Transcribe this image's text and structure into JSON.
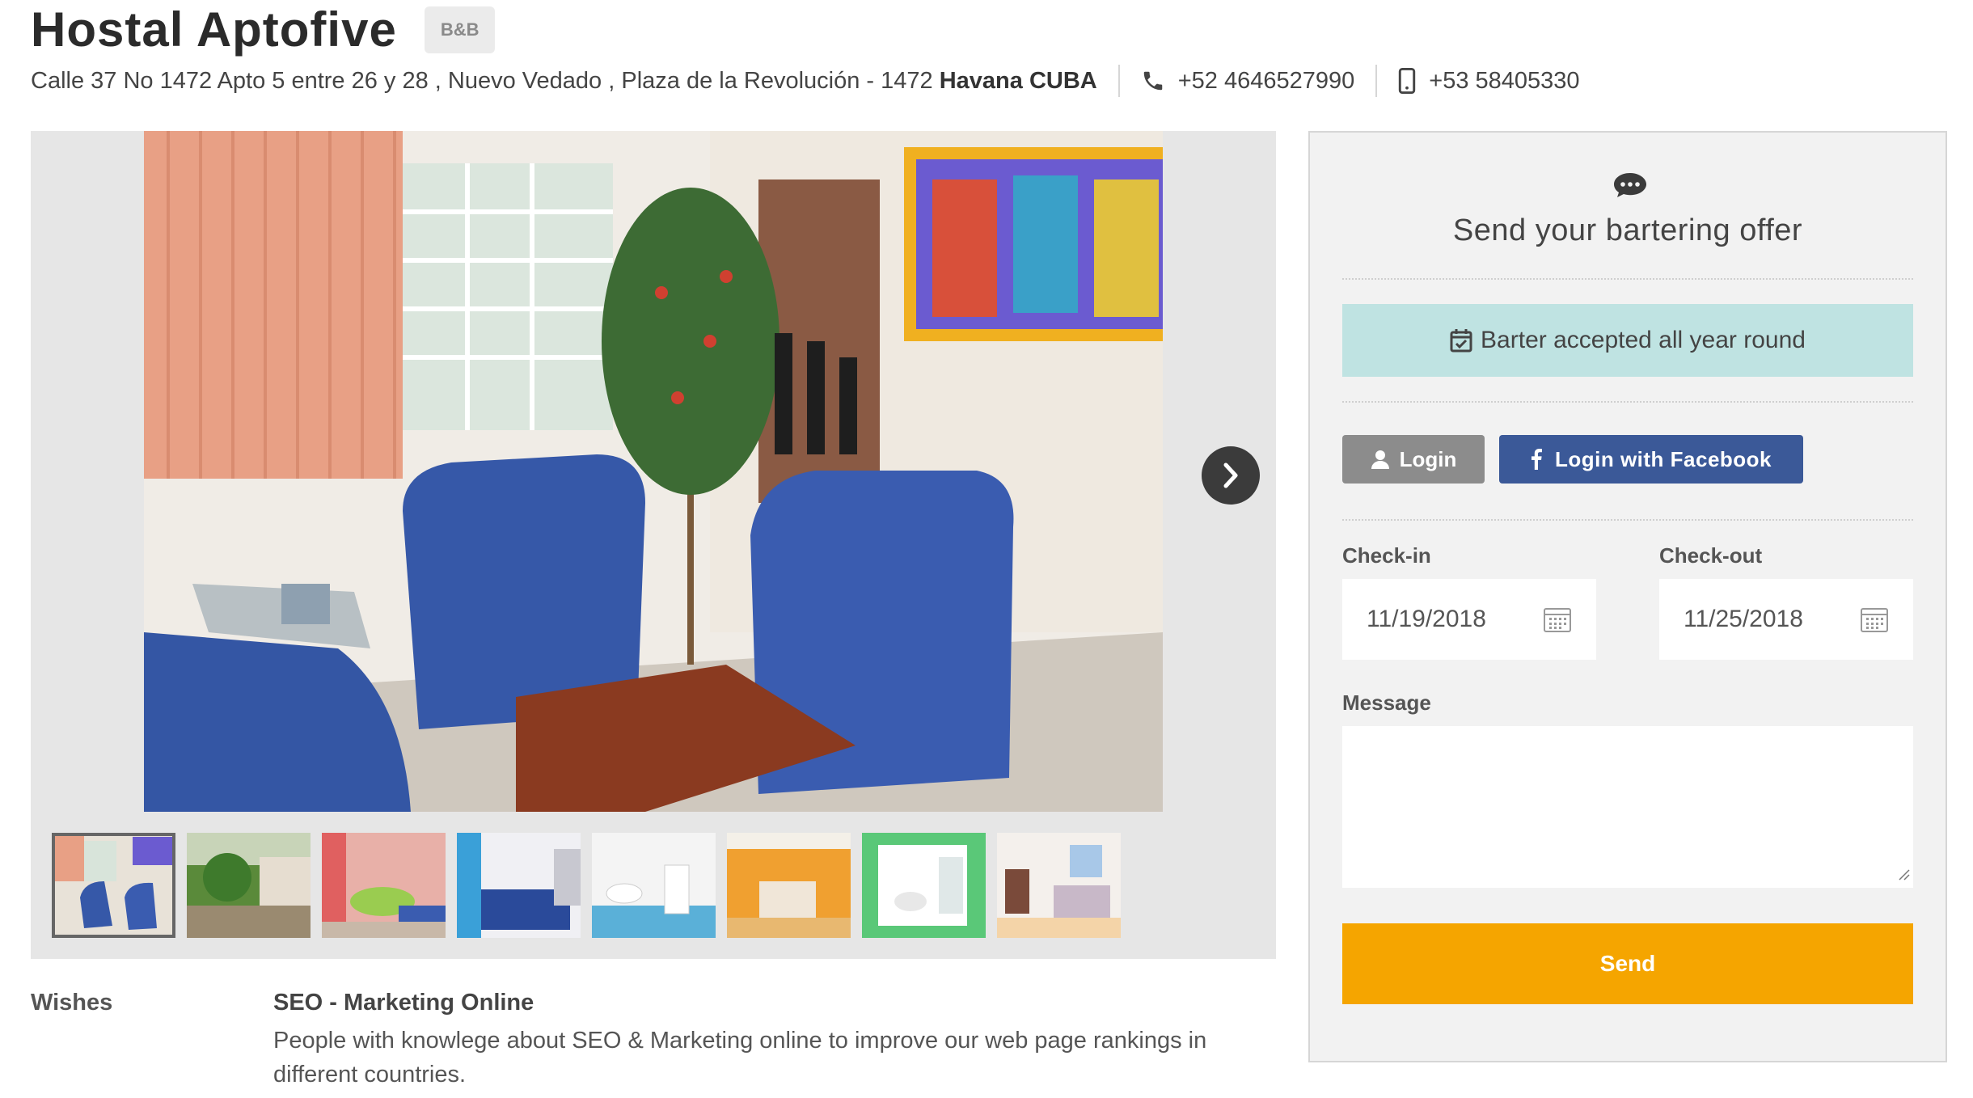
{
  "header": {
    "title": "Hostal Aptofive",
    "badge": "B&B",
    "address": "Calle 37 No 1472 Apto 5 entre 26 y 28 , Nuevo Vedado , Plaza de la Revolución - 1472",
    "city": "Havana CUBA",
    "phone": "+52 4646527990",
    "mobile": "+53 58405330",
    "phone_icon": "phone-icon",
    "mobile_icon": "mobile-icon"
  },
  "gallery": {
    "main_photo": "living-room-photo",
    "thumbnails": [
      "living-room-thumb",
      "garden-thumb",
      "dining-room-thumb",
      "blue-bedroom-thumb",
      "bathroom-thumb",
      "orange-bedroom-thumb",
      "green-bathroom-thumb",
      "bedroom-thumb"
    ],
    "active_index": 0
  },
  "wishes": {
    "label": "Wishes",
    "title": "SEO - Marketing Online",
    "description": "People with knowlege about SEO & Marketing online to improve our web page rankings in different countries."
  },
  "offer_panel": {
    "title": "Send your bartering offer",
    "barter_text": "Barter accepted all year round",
    "login_label": "Login",
    "facebook_label": "Login with Facebook",
    "checkin_label": "Check-in",
    "checkin_value": "11/19/2018",
    "checkout_label": "Check-out",
    "checkout_value": "11/25/2018",
    "message_label": "Message",
    "message_value": "",
    "send_label": "Send"
  },
  "colors": {
    "barter_bg": "#bfe3e2",
    "facebook": "#3b5998",
    "send": "#f5a500",
    "login": "#8c8c8c"
  }
}
